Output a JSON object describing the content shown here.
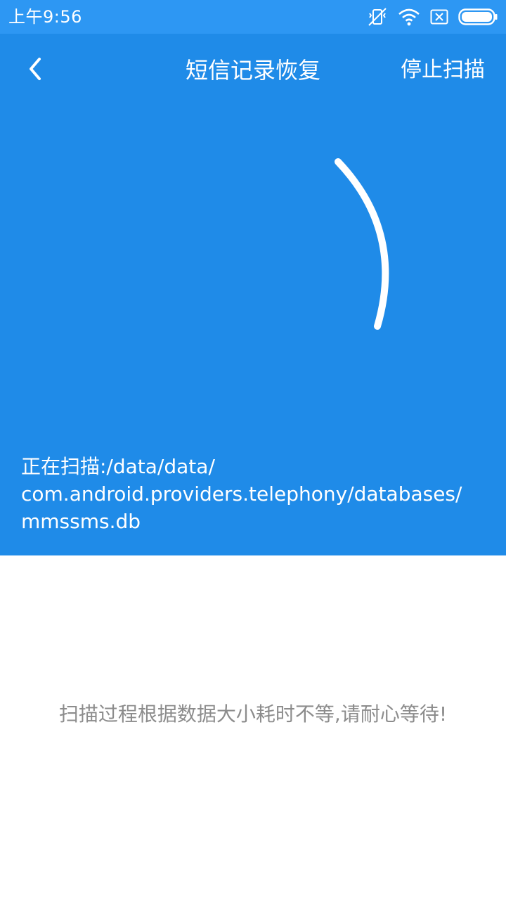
{
  "status_bar": {
    "time": "上午9:56",
    "icons": [
      "vibrate-mute-icon",
      "wifi-icon",
      "no-sim-icon",
      "battery-icon"
    ],
    "color": "#2d97f3"
  },
  "toolbar": {
    "back_icon": "chevron-left-icon",
    "title": "短信记录恢复",
    "stop_label": "停止扫描"
  },
  "scan": {
    "spinner_icon": "loading-arc-icon",
    "path_lines": [
      "正在扫描:/data/data/",
      "com.android.providers.telephony/databases/",
      "mmssms.db"
    ]
  },
  "hint": {
    "text": "扫描过程根据数据大小耗时不等,请耐心等待!"
  },
  "colors": {
    "primary": "#1f8be8",
    "text_on_primary": "#ffffff",
    "hint_text": "#8c8c8c",
    "background": "#ffffff"
  }
}
